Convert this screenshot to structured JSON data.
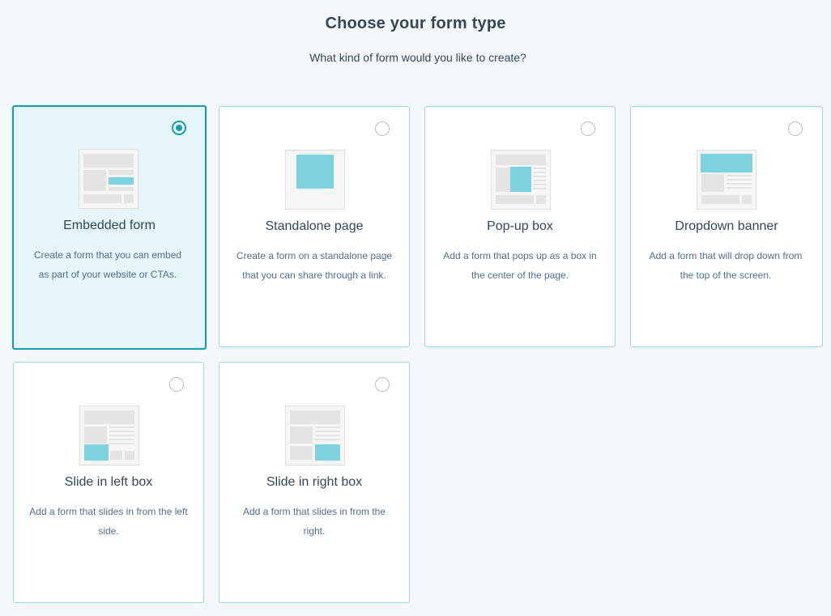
{
  "header": {
    "title": "Choose your form type",
    "subtitle": "What kind of form would you like to create?"
  },
  "colors": {
    "accent": "#0b9fb1",
    "illustration_fill": "#7fd3e0",
    "illustration_gray": "#e6e4e2",
    "selected_bg": "#e5f5f8"
  },
  "form_types": [
    {
      "id": "embedded",
      "title": "Embedded form",
      "description": "Create a form that you can embed as part of your website or CTAs.",
      "selected": true,
      "icon": "embedded-form-icon"
    },
    {
      "id": "standalone",
      "title": "Standalone page",
      "description": "Create a form on a standalone page that you can share through a link.",
      "selected": false,
      "icon": "standalone-page-icon"
    },
    {
      "id": "popup",
      "title": "Pop-up box",
      "description": "Add a form that pops up as a box in the center of the page.",
      "selected": false,
      "icon": "popup-box-icon"
    },
    {
      "id": "dropdown",
      "title": "Dropdown banner",
      "description": "Add a form that will drop down from the top of the screen.",
      "selected": false,
      "icon": "dropdown-banner-icon"
    },
    {
      "id": "slide-left",
      "title": "Slide in left box",
      "description": "Add a form that slides in from the left side.",
      "selected": false,
      "icon": "slide-in-left-icon"
    },
    {
      "id": "slide-right",
      "title": "Slide in right box",
      "description": "Add a form that slides in from the right.",
      "selected": false,
      "icon": "slide-in-right-icon"
    }
  ]
}
